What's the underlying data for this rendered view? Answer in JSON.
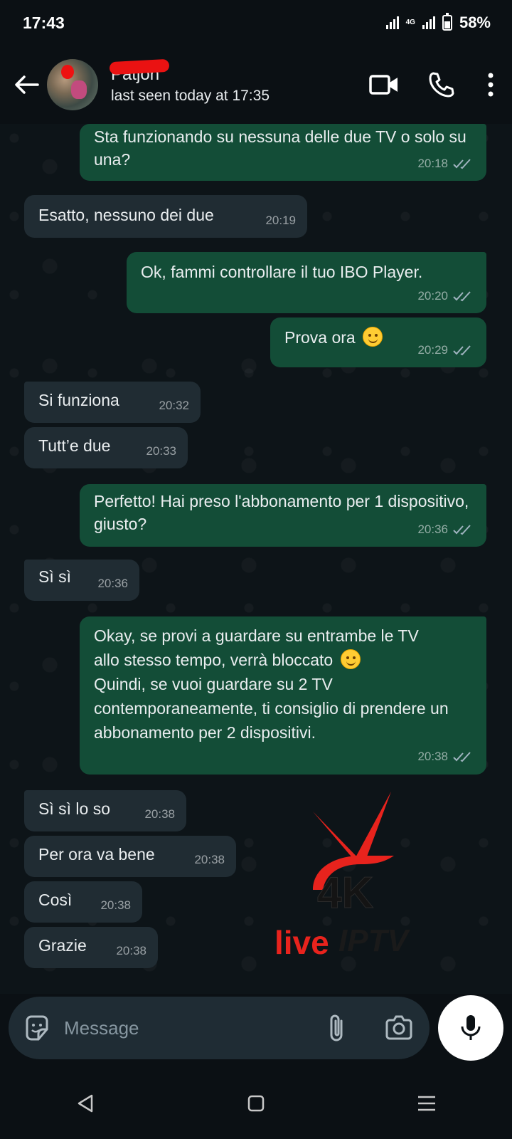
{
  "status_bar": {
    "time": "17:43",
    "network": "4G",
    "battery": "58%"
  },
  "header": {
    "contact_name": "Patjon",
    "last_seen": "last seen today at 17:35"
  },
  "messages": [
    {
      "dir": "out",
      "text": "Sta funzionando su nessuna delle due TV o solo su una?",
      "time": "20:18"
    },
    {
      "dir": "in",
      "text": "Esatto, nessuno dei due",
      "time": "20:19"
    },
    {
      "dir": "out",
      "text": "Ok, fammi controllare il tuo IBO Player.",
      "time": "20:20"
    },
    {
      "dir": "out",
      "text": "Prova ora",
      "time": "20:29"
    },
    {
      "dir": "in",
      "text": "Si funziona",
      "time": "20:32"
    },
    {
      "dir": "in",
      "text": "Tutt’e due",
      "time": "20:33"
    },
    {
      "dir": "out",
      "text": "Perfetto! Hai preso l'abbonamento per 1 dispositivo, giusto?",
      "time": "20:36"
    },
    {
      "dir": "in",
      "text": "Sì sì",
      "time": "20:36"
    },
    {
      "dir": "out",
      "text_line1": "Okay, se provi a guardare su entrambe le TV",
      "text_line2": "allo stesso tempo, verrà bloccato",
      "text_rest": "Quindi, se vuoi guardare su 2 TV contemporaneamente, ti consiglio di prendere un abbonamento per 2 dispositivi.",
      "time": "20:38"
    },
    {
      "dir": "in",
      "text": "Sì sì lo so",
      "time": "20:38"
    },
    {
      "dir": "in",
      "text": "Per ora va bene",
      "time": "20:38"
    },
    {
      "dir": "in",
      "text": "Così",
      "time": "20:38"
    },
    {
      "dir": "in",
      "text": "Grazie",
      "time": "20:38"
    }
  ],
  "watermark": {
    "line1": "4K",
    "line2_red": "live",
    "line2_dark": "IPTV"
  },
  "input": {
    "placeholder": "Message"
  },
  "colors": {
    "outgoing": "#134d37",
    "incoming": "#202c33",
    "accent_red": "#e8231d"
  }
}
